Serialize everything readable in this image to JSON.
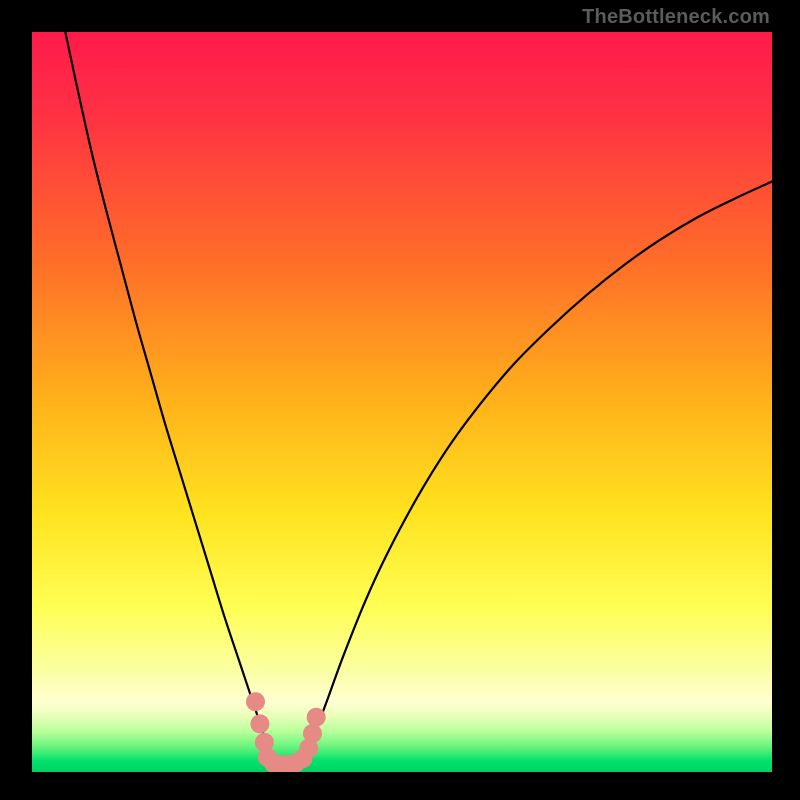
{
  "watermark": "TheBottleneck.com",
  "colors": {
    "frame": "#000000",
    "gradient_top": "#ff1a4b",
    "gradient_mid1": "#ff6a2a",
    "gradient_mid2": "#ffd21f",
    "gradient_low": "#f9ff66",
    "gradient_pale": "#ffffb0",
    "gradient_green": "#00e26b",
    "curve": "#000000",
    "marker": "#e58a84"
  },
  "chart_data": {
    "type": "line",
    "title": "",
    "xlabel": "",
    "ylabel": "",
    "xlim": [
      0,
      100
    ],
    "ylim": [
      0,
      100
    ],
    "annotations": [],
    "series": [
      {
        "name": "left-branch",
        "x": [
          4.5,
          6,
          8,
          10,
          12,
          14,
          16,
          18,
          20,
          22,
          24,
          26,
          28,
          29,
          30,
          31,
          31.8
        ],
        "y": [
          100,
          93,
          84,
          76,
          68.5,
          61,
          54,
          47,
          40.5,
          34,
          27.5,
          21,
          15,
          12,
          9,
          6,
          3.2
        ]
      },
      {
        "name": "right-branch",
        "x": [
          37.4,
          38.5,
          40,
          42,
          45,
          48,
          52,
          56,
          60,
          65,
          70,
          75,
          80,
          85,
          90,
          95,
          100
        ],
        "y": [
          3.3,
          6,
          10,
          15.5,
          23,
          29.5,
          37,
          43.5,
          49,
          55,
          60,
          64.5,
          68.5,
          72,
          75,
          77.5,
          79.8
        ]
      }
    ],
    "markers": {
      "name": "highlight-points",
      "color": "#e58a84",
      "points": [
        {
          "x": 30.2,
          "y": 9.5
        },
        {
          "x": 30.8,
          "y": 6.5
        },
        {
          "x": 31.4,
          "y": 4.0
        },
        {
          "x": 31.8,
          "y": 2.0
        },
        {
          "x": 32.6,
          "y": 1.2
        },
        {
          "x": 33.6,
          "y": 1.0
        },
        {
          "x": 34.6,
          "y": 1.0
        },
        {
          "x": 35.6,
          "y": 1.2
        },
        {
          "x": 36.6,
          "y": 1.8
        },
        {
          "x": 37.4,
          "y": 3.2
        },
        {
          "x": 37.9,
          "y": 5.2
        },
        {
          "x": 38.4,
          "y": 7.4
        }
      ]
    },
    "gradient_stops": [
      {
        "pos": 0.0,
        "color": "#ff1a4b"
      },
      {
        "pos": 0.1,
        "color": "#ff2e45"
      },
      {
        "pos": 0.3,
        "color": "#ff6a2a"
      },
      {
        "pos": 0.5,
        "color": "#ffb21a"
      },
      {
        "pos": 0.65,
        "color": "#ffe31f"
      },
      {
        "pos": 0.78,
        "color": "#ffff55"
      },
      {
        "pos": 0.86,
        "color": "#fbffa0"
      },
      {
        "pos": 0.905,
        "color": "#ffffd0"
      },
      {
        "pos": 0.925,
        "color": "#e8ffb8"
      },
      {
        "pos": 0.945,
        "color": "#b8ff9a"
      },
      {
        "pos": 0.965,
        "color": "#6cf57e"
      },
      {
        "pos": 0.985,
        "color": "#00e26b"
      },
      {
        "pos": 1.0,
        "color": "#00d064"
      }
    ]
  }
}
